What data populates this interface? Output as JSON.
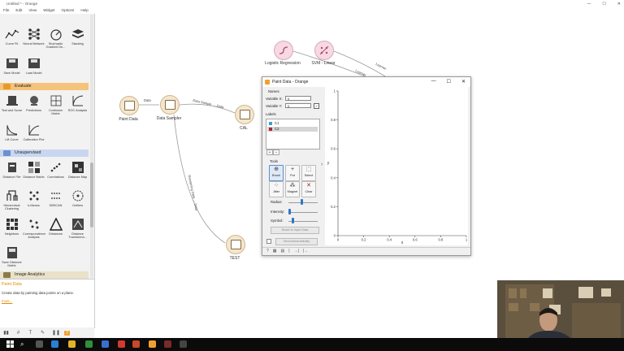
{
  "window": {
    "title": "Untitled * - Orange",
    "controls": [
      "—",
      "☐",
      "✕"
    ]
  },
  "menu": [
    "File",
    "Edit",
    "View",
    "Widget",
    "Options",
    "Help"
  ],
  "toolbox": {
    "model_widgets": [
      {
        "label": "Curve Fit",
        "icon": "curve-fit-icon"
      },
      {
        "label": "Neural Network",
        "icon": "neural-network-icon"
      },
      {
        "label": "Stochastic Gradient De...",
        "icon": "sgd-icon"
      },
      {
        "label": "Stacking",
        "icon": "stacking-icon"
      },
      {
        "label": "Save Model",
        "icon": "save-model-icon"
      },
      {
        "label": "Load Model",
        "icon": "load-model-icon"
      }
    ],
    "evaluate_label": "Evaluate",
    "evaluate_widgets": [
      {
        "label": "Test and Score",
        "icon": "test-score-icon"
      },
      {
        "label": "Predictions",
        "icon": "predictions-icon"
      },
      {
        "label": "Confusion Matrix",
        "icon": "confusion-matrix-icon"
      },
      {
        "label": "ROC Analysis",
        "icon": "roc-icon"
      },
      {
        "label": "Lift Curve",
        "icon": "lift-curve-icon"
      },
      {
        "label": "Calibration Plot",
        "icon": "calibration-plot-icon"
      }
    ],
    "unsupervised_label": "Unsupervised",
    "unsupervised_widgets": [
      {
        "label": "Distance File",
        "icon": "distance-file-icon"
      },
      {
        "label": "Distance Matrix",
        "icon": "distance-matrix-icon"
      },
      {
        "label": "Correlations",
        "icon": "correlations-icon"
      },
      {
        "label": "Distance Map",
        "icon": "distance-map-icon"
      },
      {
        "label": "Hierarchical Clustering",
        "icon": "hierarchical-clustering-icon"
      },
      {
        "label": "k-Means",
        "icon": "kmeans-icon"
      },
      {
        "label": "DBSCAN",
        "icon": "dbscan-icon"
      },
      {
        "label": "Outliers",
        "icon": "outliers-icon"
      },
      {
        "label": "Neighbors",
        "icon": "neighbors-icon"
      },
      {
        "label": "Correspondence Analysis",
        "icon": "correspondence-icon"
      },
      {
        "label": "Distances",
        "icon": "distances-icon"
      },
      {
        "label": "Distance Transforma...",
        "icon": "distance-transformation-icon"
      },
      {
        "label": "Save Distance Matrix",
        "icon": "save-distance-matrix-icon"
      }
    ],
    "image_analytics_label": "Image Analytics",
    "colors": {
      "evaluate": "#f6c37a",
      "unsupervised": "#c9d6f0",
      "image_analytics": "#e9e1c8"
    }
  },
  "info": {
    "title": "Paint Data",
    "description": "Create data by painting data points on a plane.",
    "more": "more..."
  },
  "canvas": {
    "nodes": {
      "paint_data": "Paint Data",
      "data_sampler": "Data Sampler",
      "cal": "CAL",
      "test": "TEST",
      "logreg": "Logistic Regression",
      "svm": "SVM - Linear"
    },
    "edges": {
      "data": "Data",
      "data_sample": "Data Sample → Data",
      "remaining": "Remaining Data → Data",
      "learner1": "Learner",
      "learner2": "Learner"
    }
  },
  "dialog": {
    "title": "Paint Data - Orange",
    "controls": [
      "—",
      "☐",
      "✕"
    ],
    "names_label": "Names",
    "var_x_label": "Variable X:",
    "var_x_value": "x",
    "var_y_label": "Variable Y:",
    "var_y_value": "y",
    "labels_label": "Labels",
    "classes": [
      {
        "name": "C1",
        "color": "#3d9bd6"
      },
      {
        "name": "C2",
        "color": "#b0263a"
      }
    ],
    "add": "+",
    "remove": "−",
    "tools_label": "Tools",
    "tools": [
      {
        "name": "Brush",
        "glyph": "⊕"
      },
      {
        "name": "Put",
        "glyph": "+"
      },
      {
        "name": "Select",
        "glyph": "⬚"
      },
      {
        "name": "Jitter",
        "glyph": "⁘"
      },
      {
        "name": "Magnet",
        "glyph": "⁂"
      },
      {
        "name": "Clear",
        "glyph": "✕"
      }
    ],
    "radius_label": "Radius:",
    "intensity_label": "Intensity:",
    "symbol_label": "Symbol:",
    "sliders": {
      "radius": 0.45,
      "intensity": 0.05,
      "symbol": 0.15
    },
    "reset_label": "Reset to Input Data",
    "send_label": "Send Automatically",
    "statusbar": [
      "?",
      "▦",
      "▤",
      "|",
      "→|",
      "|→"
    ],
    "collapse_glyph": "›"
  },
  "plot": {
    "xlabel": "x",
    "ylabel": "y",
    "xticks": [
      "0",
      "0.2",
      "0.4",
      "0.6",
      "0.8",
      "1"
    ],
    "yticks": [
      "0",
      "0.2",
      "0.4",
      "0.6",
      "0.8",
      "1"
    ]
  },
  "bottom_tools": [
    "▮▮",
    "#",
    "T",
    "✎",
    "❚❚",
    "?"
  ]
}
